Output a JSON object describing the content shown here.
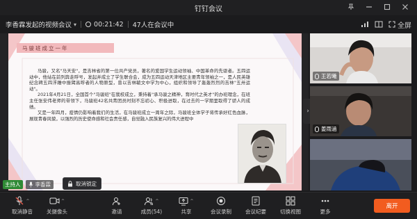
{
  "window": {
    "title": "钉钉会议"
  },
  "meeting": {
    "topic": "李香霖发起的视频会议",
    "elapsed": "00:21:42",
    "participants_status": "47人在会议中",
    "fullscreen_label": "全屏"
  },
  "slide": {
    "title": "马骏班成立一年",
    "paragraphs": [
      "马骏，又名\"马天安\"，是吉林省的第一位共产党员，著名的爱国学生运动领袖、中国革命的先驱者。五四运动中，他站在前列奔走呼号，发起并成立了学生联合会，成为五四运动天津地区主要青年领袖之一，是人民英雄纪念碑五四浮雕中振臂高呼者的人物原型，曾以吉林毓文中学为中心，组织和领导了轰轰烈烈的吉林\"五卅运动\"。",
      "2021年4月21日，全国首个\"马骏班\"在我校成立，秉持着\"承马骏之精神，育时代之英才\"的办班理念，在班主任张安伟老师的带领下，马骏班42名共青团员时刻不忘初心、积极进取，在过去的一学期里取得了骄人的成绩。",
      "又是一年四月，疫情仍影响着我们的生活，在马骏班成立一周年之际，马骏班全体学子将传承好红色血脉，展现青春风貌，以强烈的历史使命感和社会责任感，自觉融入民族复兴的伟大进程中"
    ]
  },
  "host": {
    "role": "主持人",
    "name": "李香霖"
  },
  "unlock_label": "取消锁定",
  "videos": [
    {
      "name": "王若曦"
    },
    {
      "name": "姜雨涵"
    },
    {
      "name": ""
    }
  ],
  "toolbar": {
    "mute": "取消静音",
    "camera": "关摄像头",
    "invite": "邀请",
    "members": "成员(54)",
    "share": "共享",
    "record": "会议录制",
    "minutes": "会议纪要",
    "switch_view": "切换视图",
    "more": "更多",
    "leave": "离开"
  },
  "colors": {
    "leave_button": "#f25c1f",
    "host_badge": "#2f8a35",
    "slide_accent": "#f2b9bc"
  }
}
